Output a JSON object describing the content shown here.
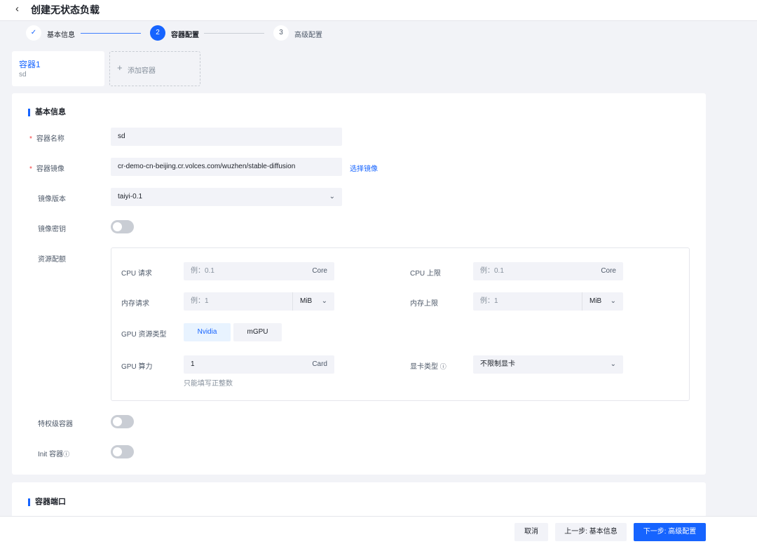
{
  "header": {
    "title": "创建无状态负载"
  },
  "steps": [
    {
      "label": "基本信息",
      "num": "✓"
    },
    {
      "label": "容器配置",
      "num": "2"
    },
    {
      "label": "高级配置",
      "num": "3"
    }
  ],
  "containers": {
    "tab_title": "容器1",
    "tab_sub": "sd",
    "add_label": "添加容器"
  },
  "basic": {
    "section_title": "基本信息",
    "name_label": "容器名称",
    "name_value": "sd",
    "image_label": "容器镜像",
    "image_value": "cr-demo-cn-beijing.cr.volces.com/wuzhen/stable-diffusion",
    "image_link": "选择镜像",
    "version_label": "镜像版本",
    "version_value": "taiyi-0.1",
    "secret_label": "镜像密钥",
    "resource_label": "资源配额",
    "privileged_label": "特权级容器",
    "init_label": "Init 容器"
  },
  "resources": {
    "cpu_req_label": "CPU 请求",
    "cpu_req_ph": "例：0.1",
    "cpu_unit": "Core",
    "cpu_lim_label": "CPU 上限",
    "cpu_lim_ph": "例：0.1",
    "mem_req_label": "内存请求",
    "mem_req_ph": "例：1",
    "mem_unit": "MiB",
    "mem_lim_label": "内存上限",
    "mem_lim_ph": "例：1",
    "gpu_type_label": "GPU 资源类型",
    "gpu_opt1": "Nvidia",
    "gpu_opt2": "mGPU",
    "gpu_power_label": "GPU 算力",
    "gpu_power_value": "1",
    "gpu_unit": "Card",
    "gpu_hint": "只能填写正整数",
    "card_type_label": "显卡类型",
    "card_type_value": "不限制显卡"
  },
  "ports": {
    "section_title": "容器端口"
  },
  "footer": {
    "cancel": "取消",
    "prev": "上一步: 基本信息",
    "next": "下一步: 高级配置"
  }
}
